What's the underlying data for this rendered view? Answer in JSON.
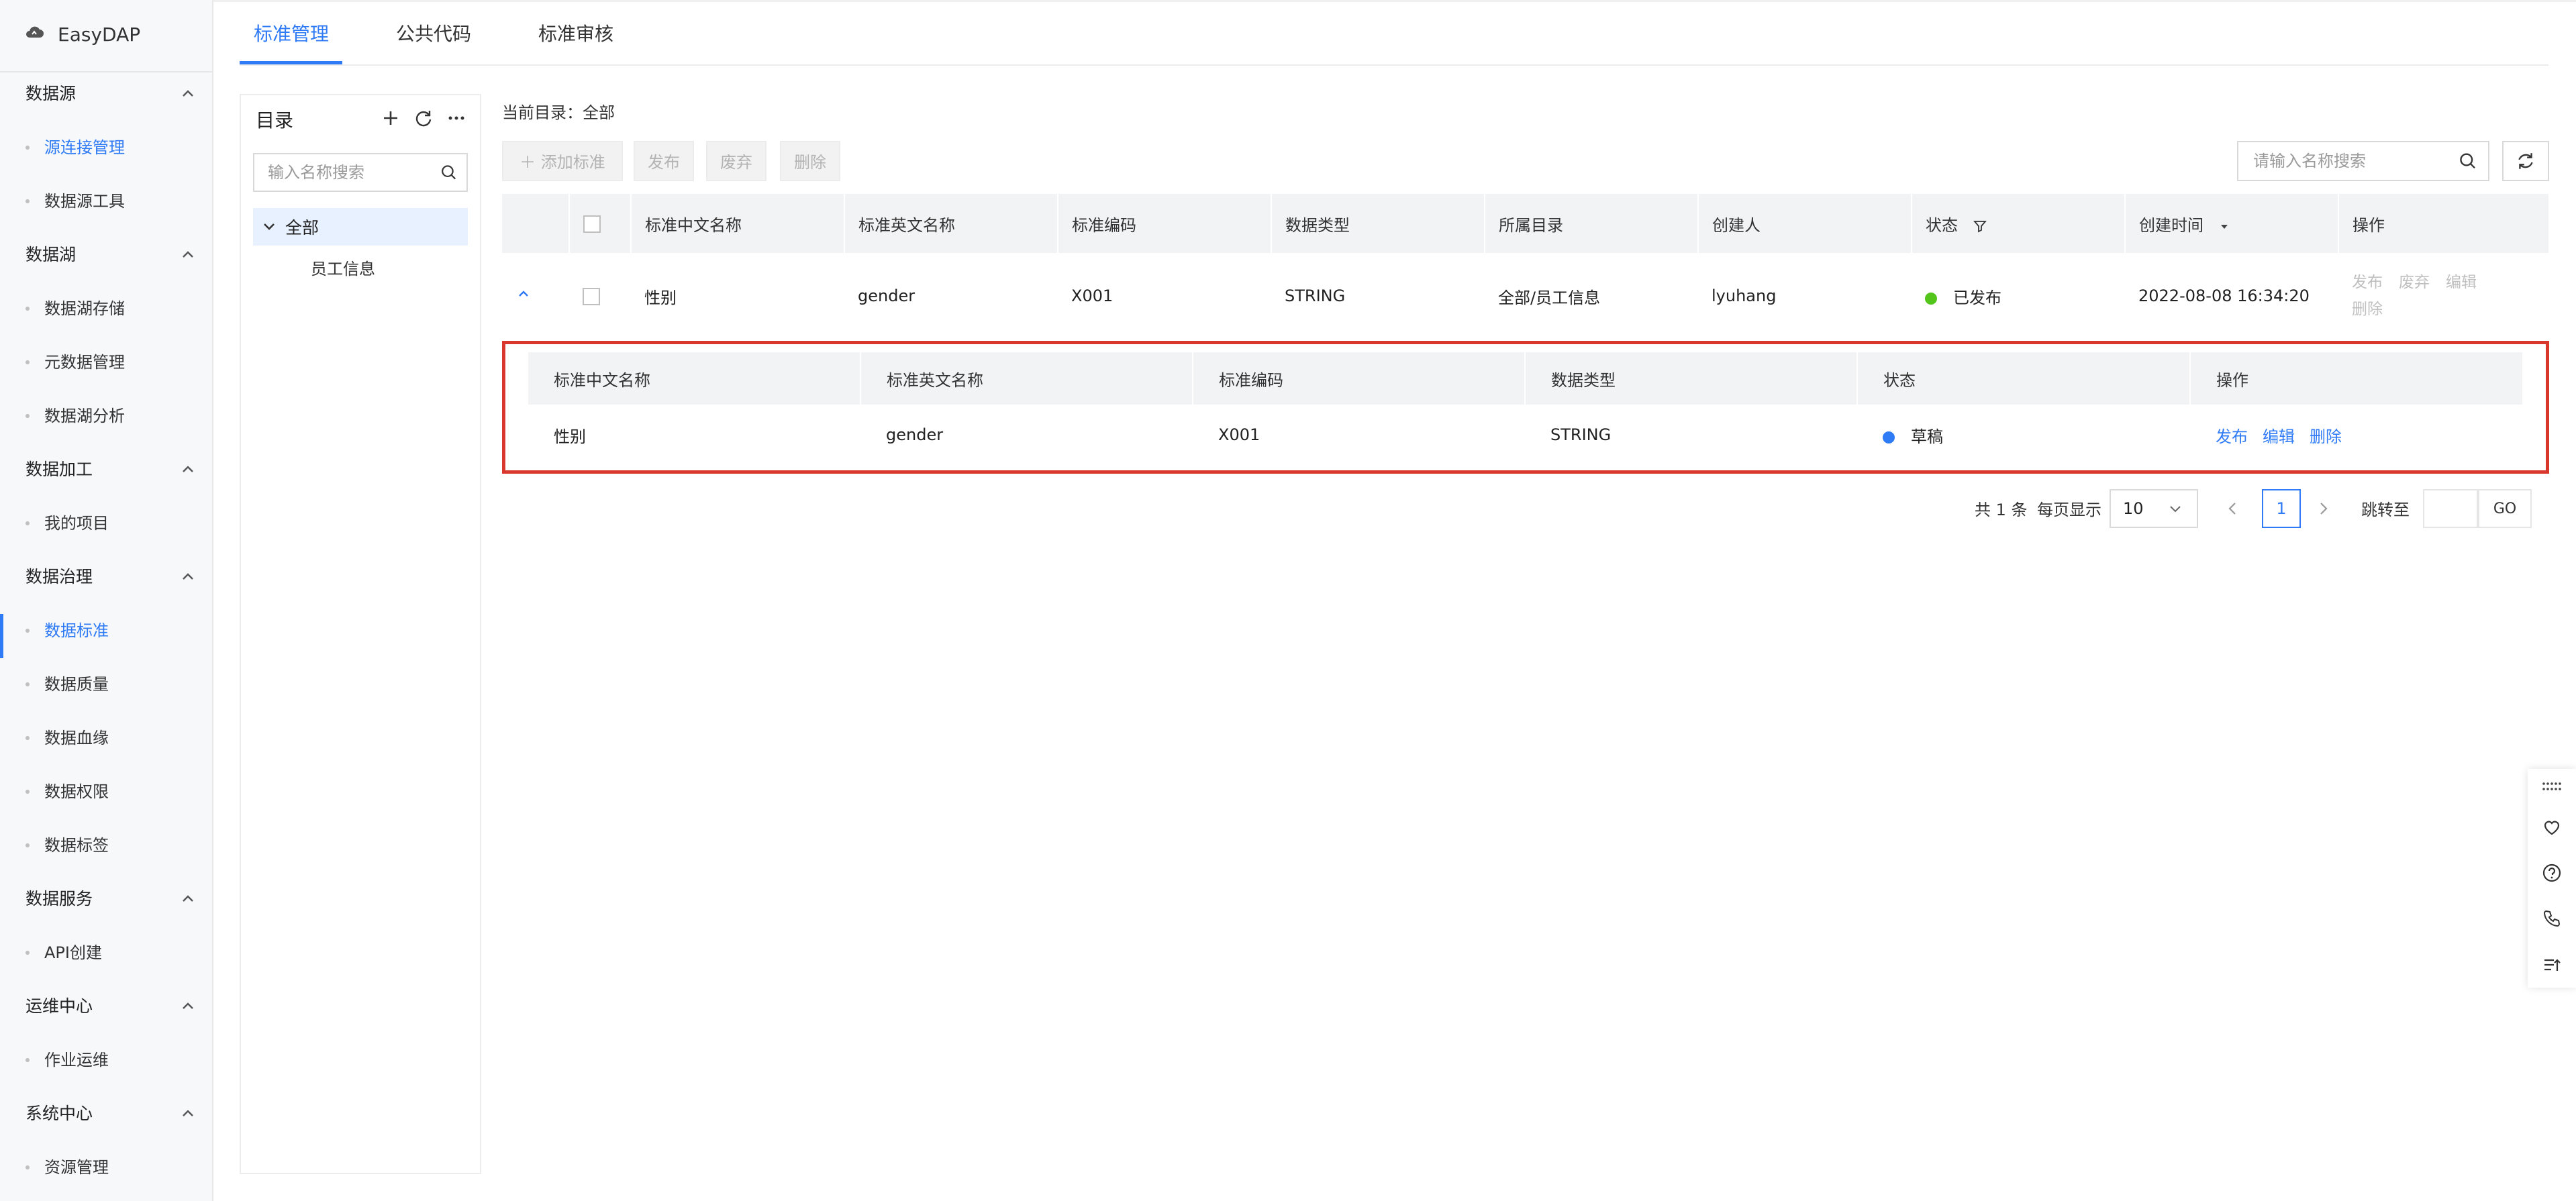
{
  "app": {
    "name": "EasyDAP"
  },
  "sidebar": {
    "groups": [
      {
        "title": "数据源",
        "items": [
          "源连接管理",
          "数据源工具"
        ]
      },
      {
        "title": "数据湖",
        "items": [
          "数据湖存储",
          "元数据管理",
          "数据湖分析"
        ]
      },
      {
        "title": "数据加工",
        "items": [
          "我的项目"
        ]
      },
      {
        "title": "数据治理",
        "items": [
          "数据标准",
          "数据质量",
          "数据血缘",
          "数据权限",
          "数据标签"
        ]
      },
      {
        "title": "数据服务",
        "items": [
          "API创建"
        ]
      },
      {
        "title": "运维中心",
        "items": [
          "作业运维"
        ]
      },
      {
        "title": "系统中心",
        "items": [
          "资源管理"
        ]
      }
    ],
    "active_item": "数据标准"
  },
  "tabs": [
    {
      "label": "标准管理"
    },
    {
      "label": "公共代码"
    },
    {
      "label": "标准审核"
    }
  ],
  "directory": {
    "title": "目录",
    "search_placeholder": "输入名称搜索",
    "tree": {
      "root": "全部",
      "children": [
        "员工信息"
      ]
    }
  },
  "main": {
    "crumb": "当前目录：全部",
    "toolbar": {
      "add": "添加标准",
      "publish": "发布",
      "discard": "废弃",
      "delete": "删除"
    },
    "search_placeholder": "请输入名称搜索",
    "columns": [
      "标准中文名称",
      "标准英文名称",
      "标准编码",
      "数据类型",
      "所属目录",
      "创建人",
      "状态",
      "创建时间",
      "操作"
    ],
    "rows": [
      {
        "cn_name": "性别",
        "en_name": "gender",
        "code": "X001",
        "type": "STRING",
        "dir": "全部/员工信息",
        "creator": "lyuhang",
        "status": "已发布",
        "created": "2022-08-08 16:34:20",
        "ops": [
          "发布",
          "废弃",
          "编辑",
          "删除"
        ]
      }
    ],
    "subtable": {
      "columns": [
        "标准中文名称",
        "标准英文名称",
        "标准编码",
        "数据类型",
        "状态",
        "操作"
      ],
      "rows": [
        {
          "cn_name": "性别",
          "en_name": "gender",
          "code": "X001",
          "type": "STRING",
          "status": "草稿",
          "ops": [
            "发布",
            "编辑",
            "删除"
          ]
        }
      ]
    },
    "pagination": {
      "total": "共 1 条",
      "page_size_label": "每页显示",
      "page_size": "10",
      "current_page": "1",
      "goto_label": "跳转至",
      "go": "GO"
    }
  },
  "colors": {
    "accent": "#2f7bf5",
    "published": "#52c41a",
    "draft": "#2f7bf5",
    "highlight": "#d9372b"
  }
}
